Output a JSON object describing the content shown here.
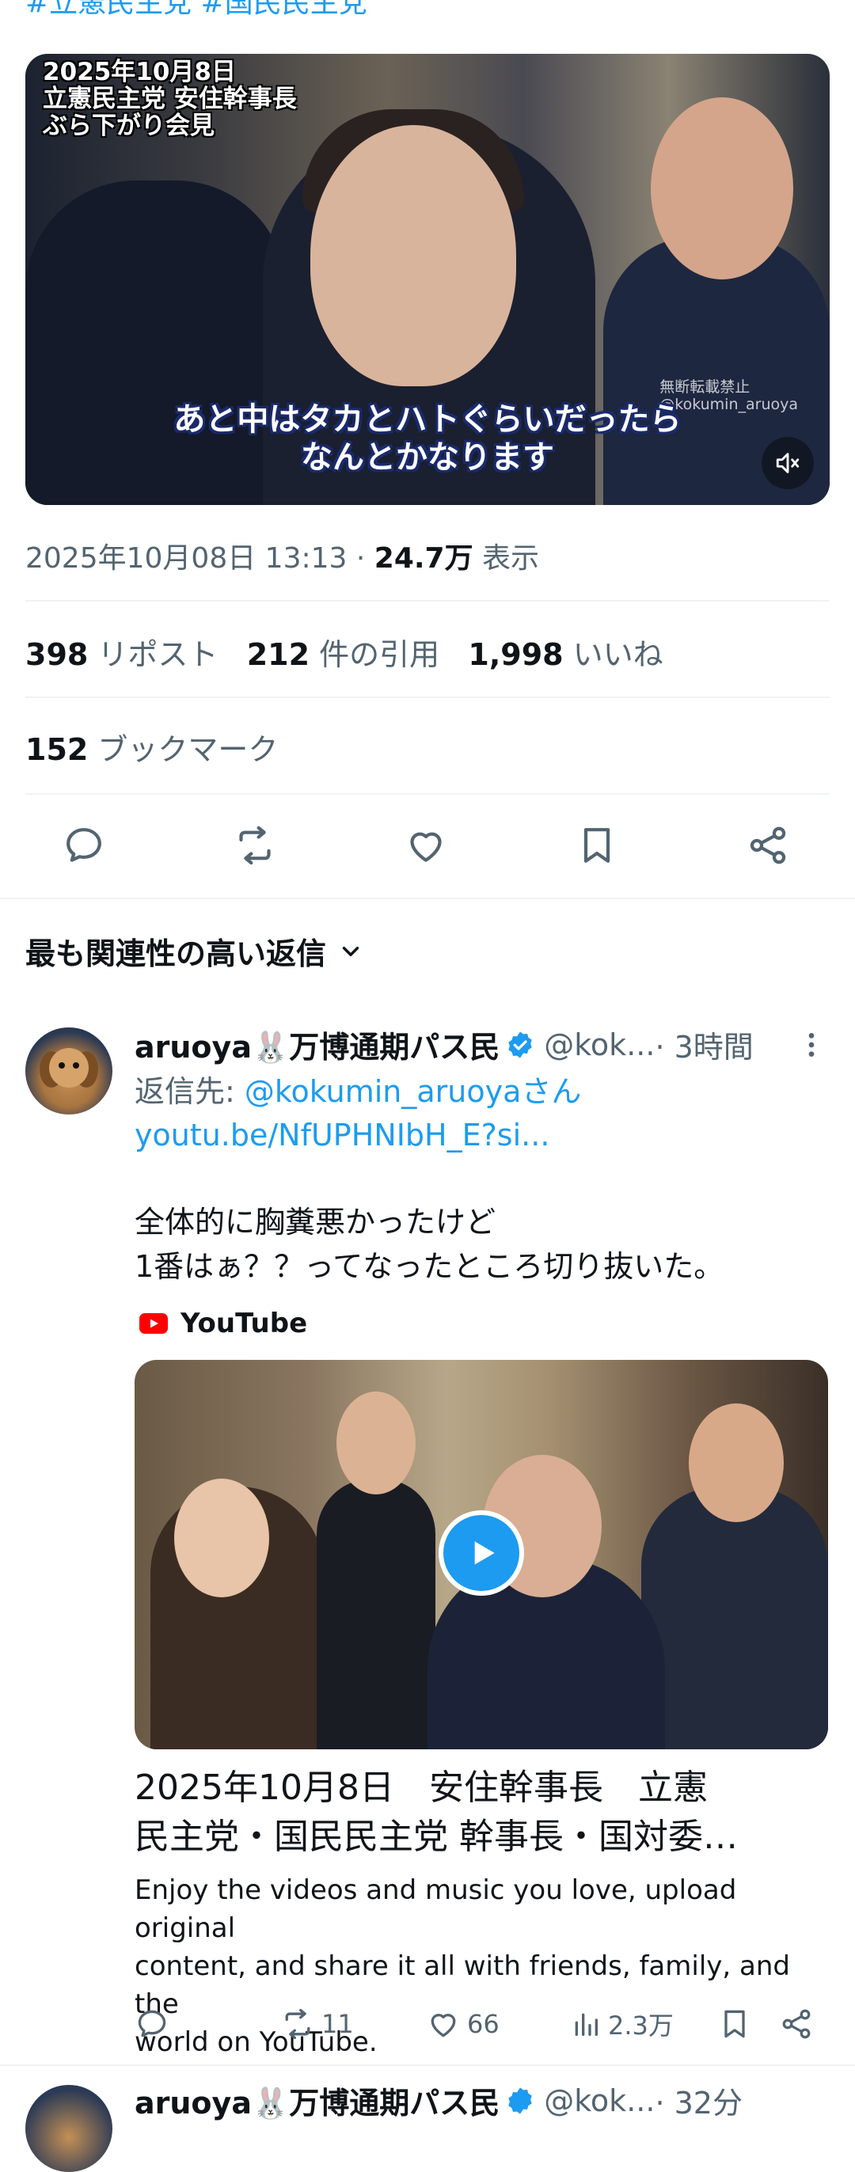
{
  "top_hashtags": "#立憲民主党  #国民民主党",
  "main_video": {
    "caption_lines": [
      "2025年10月8日",
      "立憲民主党 安住幹事長",
      "ぶら下がり会見"
    ],
    "subtitle_lines": [
      "あと中はタカとハトぐらいだったら",
      "なんとかなります"
    ],
    "watermark_lines": [
      "無断転載禁止",
      "@kokumin_aruoya"
    ],
    "mute_icon": "speaker-muted-icon"
  },
  "post_meta": {
    "timestamp": "2025年10月08日 13:13",
    "separator": " · ",
    "views_count": "24.7万",
    "views_label": " 表示"
  },
  "stats": {
    "reposts_count": "398",
    "reposts_label": "リポスト",
    "quotes_count": "212",
    "quotes_label": "件の引用",
    "likes_count": "1,998",
    "likes_label": "いいね",
    "bookmarks_count": "152",
    "bookmarks_label": "ブックマーク"
  },
  "actions": [
    "reply-icon",
    "repost-icon",
    "like-icon",
    "bookmark-icon",
    "share-icon"
  ],
  "replies_header": {
    "label": "最も関連性の高い返信"
  },
  "reply": {
    "display_name": "aruoya🐰万博通期パス民",
    "handle": "@kok...",
    "time": " · 3時間",
    "reply_to_label": "返信先: ",
    "reply_to_handle": "@kokumin_aruoyaさん",
    "link": "youtu.be/NfUPHNIbH_E?si...",
    "text_lines": [
      "全体的に胸糞悪かったけど",
      "1番はぁ？？ってなったところ切り抜いた。"
    ],
    "card": {
      "source": "YouTube",
      "title_lines": [
        "2025年10月8日　安住幹事長　立憲",
        "民主党・国民民主党 幹事長・国対委…"
      ],
      "description_lines": [
        "Enjoy the videos and music you love, upload original",
        "content, and share it all with friends, family, and the",
        "world on YouTube."
      ]
    },
    "actions": {
      "reposts": "11",
      "likes": "66",
      "views": "2.3万"
    }
  },
  "next_reply": {
    "display_name": "aruoya🐰万博通期パス民",
    "handle": "@kok...",
    "time": " · 32分"
  },
  "colors": {
    "accent": "#1d9bf0",
    "text": "#0f1419",
    "secondary": "#536471",
    "divider": "#eff3f4",
    "youtube_red": "#ff0000"
  }
}
